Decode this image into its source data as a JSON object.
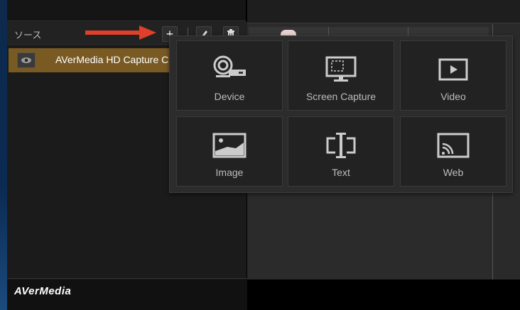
{
  "sources_panel": {
    "title": "ソース",
    "add_symbol": "+",
    "items": [
      {
        "label": "AVerMedia HD Capture C",
        "visible": true
      }
    ]
  },
  "footer": {
    "logo": "AVerMedia"
  },
  "add_source_menu": {
    "tiles": [
      {
        "label": "Device",
        "icon": "webcam-icon"
      },
      {
        "label": "Screen Capture",
        "icon": "monitor-capture-icon"
      },
      {
        "label": "Video",
        "icon": "video-play-icon"
      },
      {
        "label": "Image",
        "icon": "image-icon"
      },
      {
        "label": "Text",
        "icon": "text-cursor-icon"
      },
      {
        "label": "Web",
        "icon": "cast-web-icon"
      }
    ]
  },
  "colors": {
    "selected_row": "#7a5a23",
    "arrow": "#e0402a",
    "tile_bg": "#222222",
    "popup_bg": "#2c2c2c"
  }
}
